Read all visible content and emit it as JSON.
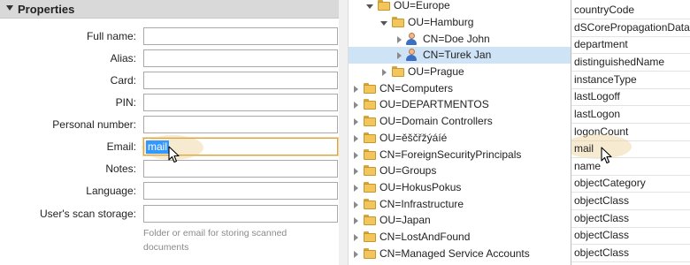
{
  "properties": {
    "title": "Properties",
    "fields": [
      {
        "label": "Full name:",
        "value": ""
      },
      {
        "label": "Alias:",
        "value": ""
      },
      {
        "label": "Card:",
        "value": ""
      },
      {
        "label": "PIN:",
        "value": ""
      },
      {
        "label": "Personal number:",
        "value": ""
      },
      {
        "label": "Email:",
        "value": "mail"
      },
      {
        "label": "Notes:",
        "value": ""
      },
      {
        "label": "Language:",
        "value": ""
      },
      {
        "label": "User's scan storage:",
        "value": ""
      }
    ],
    "scan_storage_hint": "Folder or email for storing scanned documents"
  },
  "tree": {
    "nodes": [
      {
        "label": "OU=Europe",
        "icon": "folder-icon",
        "expanded": true
      },
      {
        "label": "OU=Hamburg",
        "icon": "folder-icon",
        "expanded": true
      },
      {
        "label": "CN=Doe John",
        "icon": "user-icon",
        "expanded": false
      },
      {
        "label": "CN=Turek Jan",
        "icon": "user-icon",
        "expanded": false,
        "selected": true
      },
      {
        "label": "OU=Prague",
        "icon": "folder-icon",
        "expanded": false
      },
      {
        "label": "CN=Computers",
        "icon": "folder-icon",
        "expanded": false
      },
      {
        "label": "OU=DEPARTMENTOS",
        "icon": "folder-icon",
        "expanded": false
      },
      {
        "label": "OU=Domain Controllers",
        "icon": "folder-icon",
        "expanded": false
      },
      {
        "label": "OU=ěščřžýáíé",
        "icon": "folder-icon",
        "expanded": false
      },
      {
        "label": "CN=ForeignSecurityPrincipals",
        "icon": "folder-icon",
        "expanded": false
      },
      {
        "label": "OU=Groups",
        "icon": "folder-icon",
        "expanded": false
      },
      {
        "label": "OU=HokusPokus",
        "icon": "folder-icon",
        "expanded": false
      },
      {
        "label": "CN=Infrastructure",
        "icon": "folder-icon",
        "expanded": false
      },
      {
        "label": "OU=Japan",
        "icon": "folder-icon",
        "expanded": false
      },
      {
        "label": "CN=LostAndFound",
        "icon": "folder-icon",
        "expanded": false
      },
      {
        "label": "CN=Managed Service Accounts",
        "icon": "folder-icon",
        "expanded": false
      }
    ]
  },
  "attributes": {
    "items": [
      "countryCode",
      "dSCorePropagationData",
      "department",
      "distinguishedName",
      "instanceType",
      "lastLogoff",
      "lastLogon",
      "logonCount",
      "mail",
      "name",
      "objectCategory",
      "objectClass",
      "objectClass",
      "objectClass",
      "objectClass"
    ],
    "selected": "mail"
  },
  "colors": {
    "accent_highlight": "#ecd096",
    "selection_blue": "#3399ff",
    "tree_selected": "#cfe3f7",
    "folder": "#f2c65a"
  }
}
